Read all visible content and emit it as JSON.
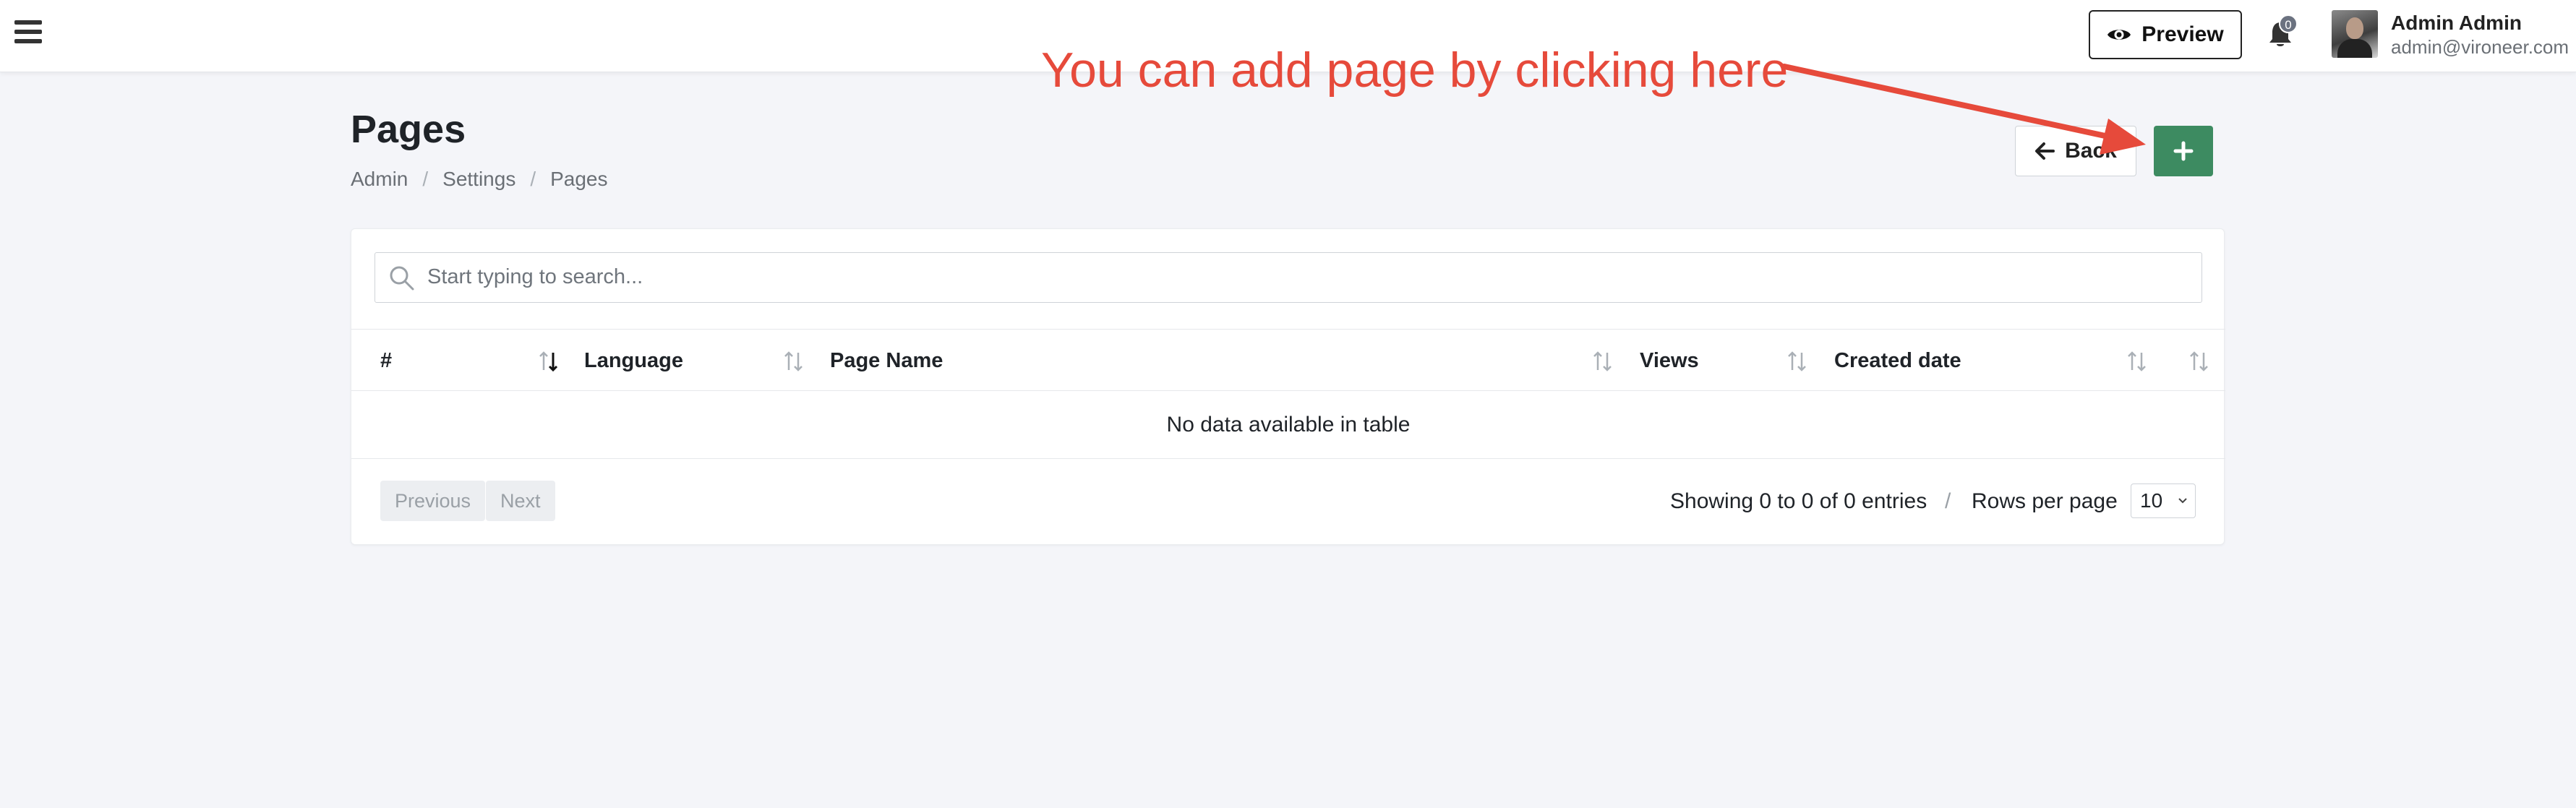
{
  "topbar": {
    "menu_icon": "hamburger-icon",
    "preview_label": "Preview",
    "notification_count": "0",
    "user_name": "Admin Admin",
    "user_email": "admin@vironeer.com"
  },
  "page": {
    "title": "Pages",
    "breadcrumb": [
      "Admin",
      "Settings",
      "Pages"
    ],
    "back_label": "Back",
    "add_icon": "plus-icon"
  },
  "search": {
    "placeholder": "Start typing to search..."
  },
  "table": {
    "columns": [
      "#",
      "Language",
      "Page Name",
      "Views",
      "Created date",
      ""
    ],
    "empty_message": "No data available in table"
  },
  "pagination": {
    "previous_label": "Previous",
    "next_label": "Next",
    "info": "Showing 0 to 0 of 0 entries",
    "separator": "/",
    "rows_per_page_label": "Rows per page",
    "rows_per_page_value": "10"
  },
  "annotation": {
    "text": "You can add page by clicking here"
  },
  "colors": {
    "accent_green": "#3d8b61",
    "annotation_red": "#e64a3b",
    "background": "#f4f5f9"
  }
}
